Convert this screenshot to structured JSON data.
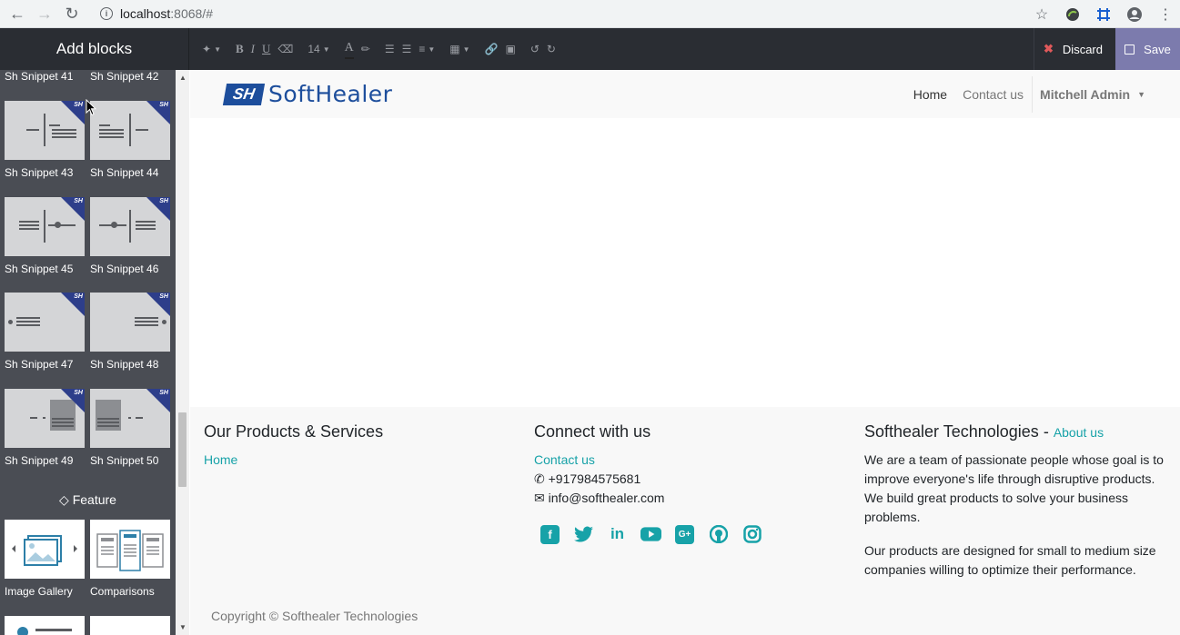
{
  "browser": {
    "url_host": "localhost",
    "url_rest": ":8068/#"
  },
  "editor": {
    "sidebar_title": "Add blocks",
    "font_size": "14",
    "discard_label": "Discard",
    "save_label": "Save"
  },
  "sidebar": {
    "snippets": [
      {
        "label": "Sh Snippet 41"
      },
      {
        "label": "Sh Snippet 42"
      },
      {
        "label": "Sh Snippet 43"
      },
      {
        "label": "Sh Snippet 44"
      },
      {
        "label": "Sh Snippet 45"
      },
      {
        "label": "Sh Snippet 46"
      },
      {
        "label": "Sh Snippet 47"
      },
      {
        "label": "Sh Snippet 48"
      },
      {
        "label": "Sh Snippet 49"
      },
      {
        "label": "Sh Snippet 50"
      }
    ],
    "badge_text": "SH",
    "feature_title": "Feature",
    "features": [
      {
        "label": "Image Gallery"
      },
      {
        "label": "Comparisons"
      }
    ]
  },
  "site": {
    "logo_mark": "SH",
    "logo_text": "SoftHealer",
    "nav": [
      {
        "label": "Home"
      },
      {
        "label": "Contact us"
      }
    ],
    "user": "Mitchell Admin"
  },
  "footer": {
    "col1": {
      "title": "Our Products & Services",
      "links": [
        "Home"
      ]
    },
    "col2": {
      "title": "Connect with us",
      "contact_link": "Contact us",
      "phone": "+917984575681",
      "email": "info@softhealer.com"
    },
    "col3": {
      "title": "Softhealer Technologies",
      "title_sep": " - ",
      "about_link": "About us",
      "para1": "We are a team of passionate people whose goal is to improve everyone's life through disruptive products. We build great products to solve your business problems.",
      "para2": "Our products are designed for small to medium size companies willing to optimize their performance."
    },
    "copyright": "Copyright © Softhealer Technologies"
  },
  "colors": {
    "accent": "#17a2a8",
    "brand": "#1d4e9c",
    "save_bg": "#7c7bad",
    "editor_bg": "#2a2d33"
  }
}
